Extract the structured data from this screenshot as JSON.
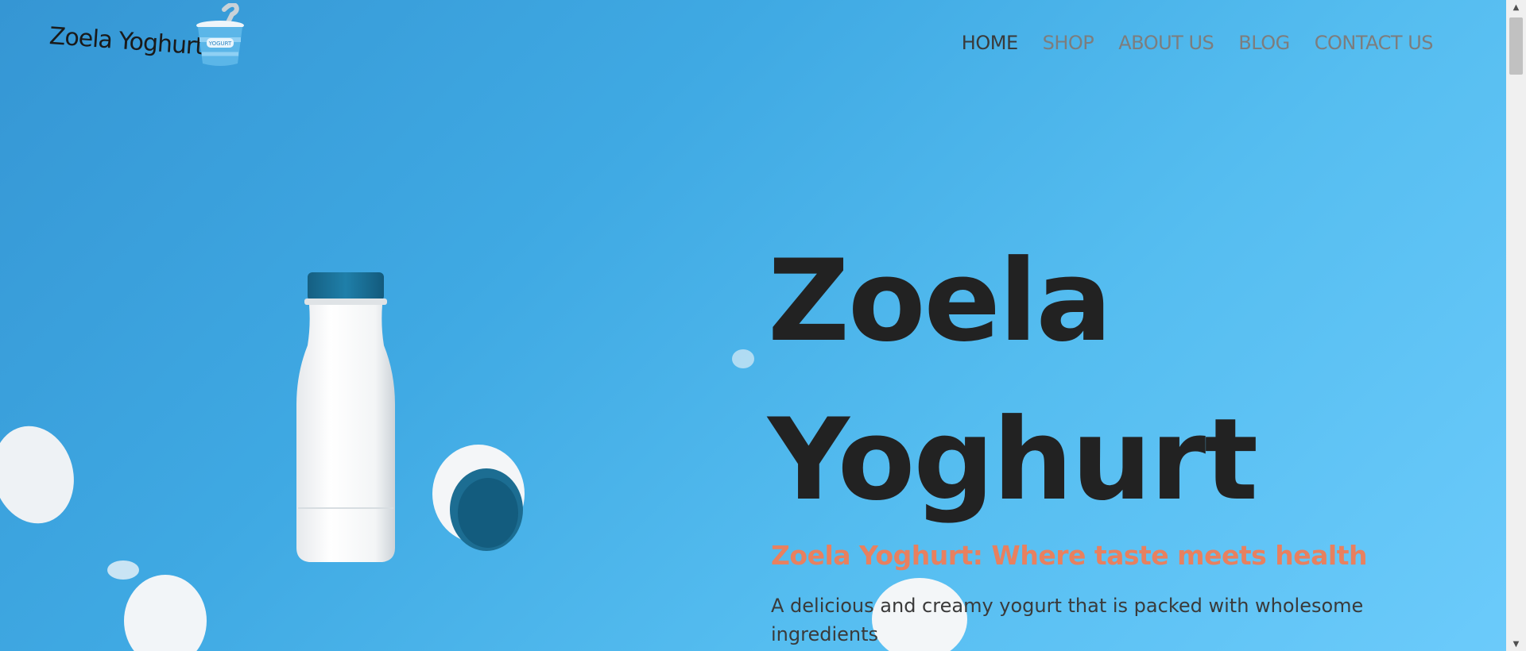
{
  "brand": {
    "logo_text": "Zoela Yoghurt",
    "cup_label": "YOGURT"
  },
  "nav": {
    "items": [
      {
        "label": "HOME",
        "active": true
      },
      {
        "label": "SHOP",
        "active": false
      },
      {
        "label": "ABOUT US",
        "active": false
      },
      {
        "label": "BLOG",
        "active": false
      },
      {
        "label": "CONTACT US",
        "active": false
      }
    ]
  },
  "hero": {
    "title_line1": "Zoela",
    "title_line2": "Yoghurt",
    "tagline": "Zoela Yoghurt: Where taste meets health",
    "description": "A delicious and creamy yogurt that is packed with wholesome ingredients"
  },
  "colors": {
    "background": "#3fa9e3",
    "title": "#222222",
    "tagline": "#e8805f",
    "nav_active": "#3a3a3a",
    "nav_inactive": "#7d7d7d",
    "bottle_cap": "#1a6f96"
  },
  "icons": {
    "scroll_up": "scroll-up-arrow-icon",
    "scroll_down": "scroll-down-arrow-icon"
  }
}
